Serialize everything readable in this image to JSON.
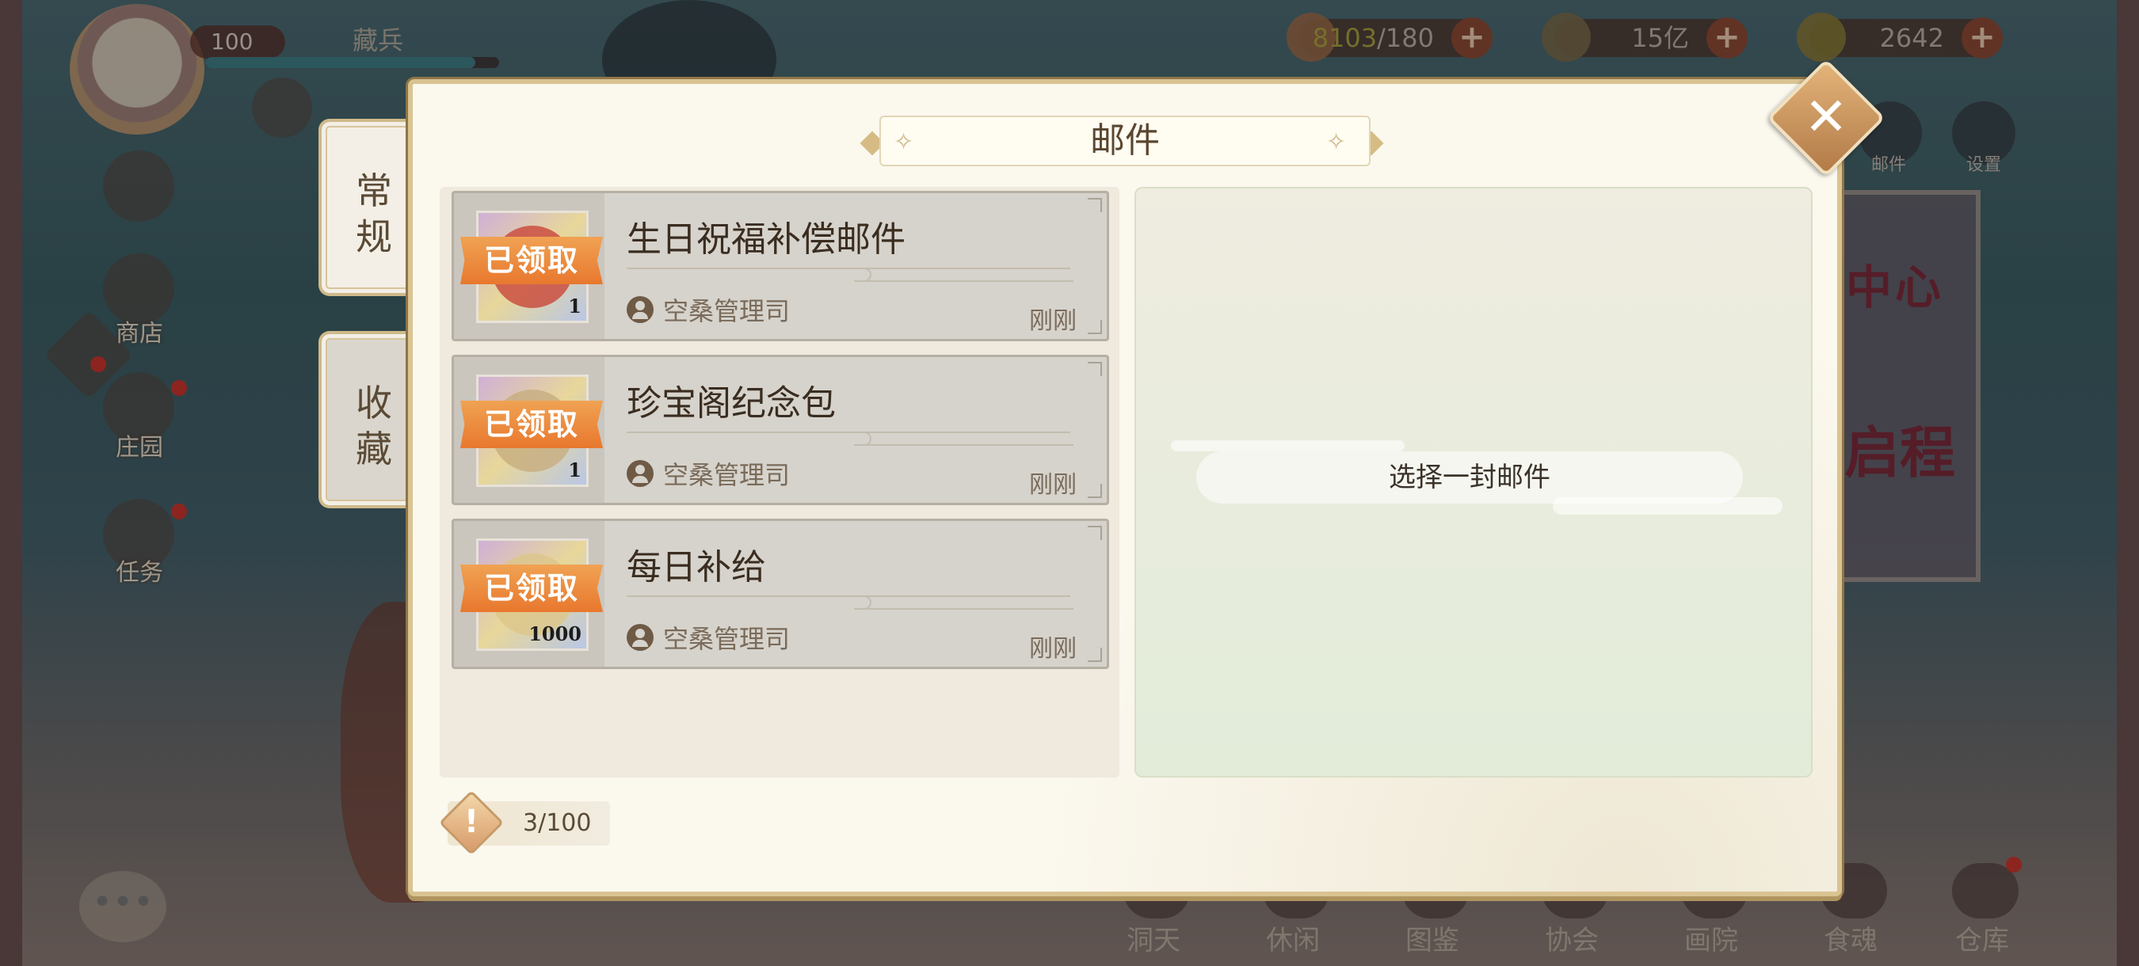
{
  "hud": {
    "level": "100",
    "player_name": "藏兵",
    "stamina": {
      "current": "8103",
      "max": "/180"
    },
    "currency_1": "15亿",
    "currency_2": "2642"
  },
  "left_menu": [
    {
      "label": "商店"
    },
    {
      "label": "庄园"
    },
    {
      "label": "任务"
    }
  ],
  "right_icons": [
    {
      "label": "邮件"
    },
    {
      "label": "设置"
    }
  ],
  "bottom_nav": [
    "洞天",
    "休闲",
    "图鉴",
    "协会",
    "画院",
    "食魂",
    "仓库"
  ],
  "poster": {
    "line1": "中心",
    "line2": "启程"
  },
  "side_tabs": [
    {
      "label": "常规",
      "active": true
    },
    {
      "label": "收藏",
      "active": false
    }
  ],
  "modal": {
    "title": "邮件",
    "empty_hint": "选择一封邮件",
    "mail_count": "3/100",
    "badge_symbol": "!"
  },
  "mails": [
    {
      "title": "生日祝福补偿邮件",
      "sender": "空桑管理司",
      "time": "刚刚",
      "status": "已领取",
      "item_count": "1"
    },
    {
      "title": "珍宝阁纪念包",
      "sender": "空桑管理司",
      "time": "刚刚",
      "status": "已领取",
      "item_count": "1"
    },
    {
      "title": "每日补给",
      "sender": "空桑管理司",
      "time": "刚刚",
      "status": "已领取",
      "item_count": "1000"
    }
  ],
  "icons": {
    "close": "close-icon",
    "user": "user-icon",
    "warning": "warning-icon"
  }
}
